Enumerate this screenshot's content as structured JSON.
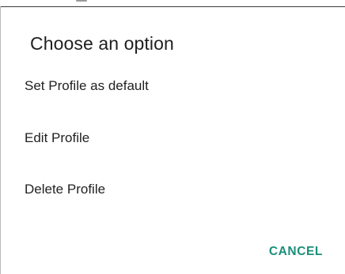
{
  "dialog": {
    "title": "Choose an option",
    "options": [
      {
        "label": "Set Profile as default"
      },
      {
        "label": "Edit Profile"
      },
      {
        "label": "Delete Profile"
      }
    ],
    "cancel_label": "CANCEL"
  },
  "colors": {
    "accent": "#1a8f7a",
    "text": "#222222",
    "background": "#ffffff"
  }
}
